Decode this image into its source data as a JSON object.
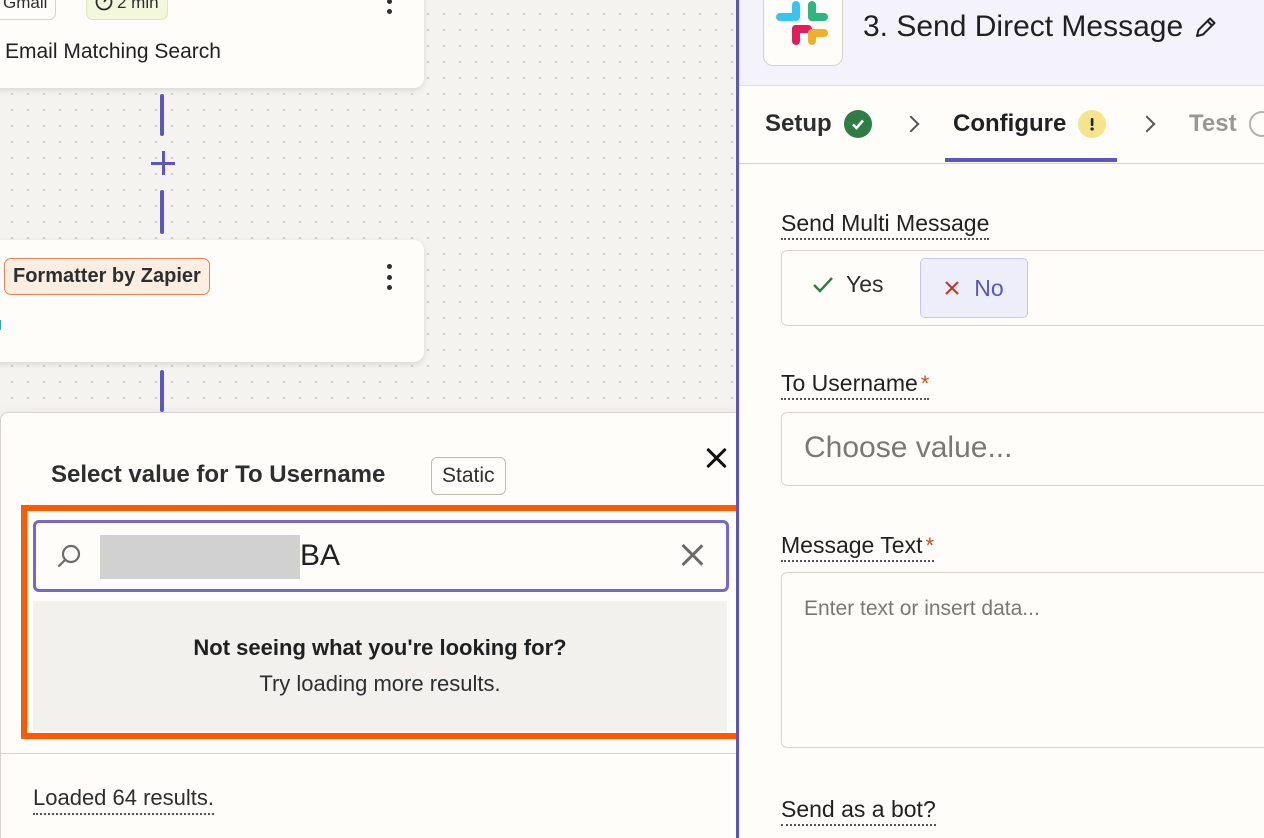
{
  "canvas": {
    "step1": {
      "app_pill": "Gmail",
      "time_pill": "2 min",
      "title": "Email Matching Search"
    },
    "step2": {
      "app_pill": "Formatter by Zapier"
    }
  },
  "popover": {
    "title": "Select value for To Username",
    "badge": "Static",
    "search_value": "BA",
    "empty_heading": "Not seeing what you're looking for?",
    "empty_sub": "Try loading more results.",
    "loaded_text": "Loaded 64 results."
  },
  "panel": {
    "title": "3. Send Direct Message",
    "tabs": [
      {
        "label": "Setup",
        "status": "complete"
      },
      {
        "label": "Configure",
        "status": "warning"
      },
      {
        "label": "Test",
        "status": "pending"
      }
    ],
    "fields": {
      "send_multi": {
        "label": "Send Multi Message",
        "yes": "Yes",
        "no": "No",
        "selected": "No"
      },
      "to_username": {
        "label": "To Username",
        "required": "*",
        "placeholder": "Choose value..."
      },
      "message_text": {
        "label": "Message Text",
        "required": "*",
        "placeholder": "Enter text or insert data..."
      },
      "send_as_bot": {
        "label": "Send as a bot?"
      }
    }
  },
  "colors": {
    "accent": "#5b57c2",
    "highlight": "#ff5a00",
    "success": "#2e7d45",
    "warning": "#f4e58a"
  }
}
